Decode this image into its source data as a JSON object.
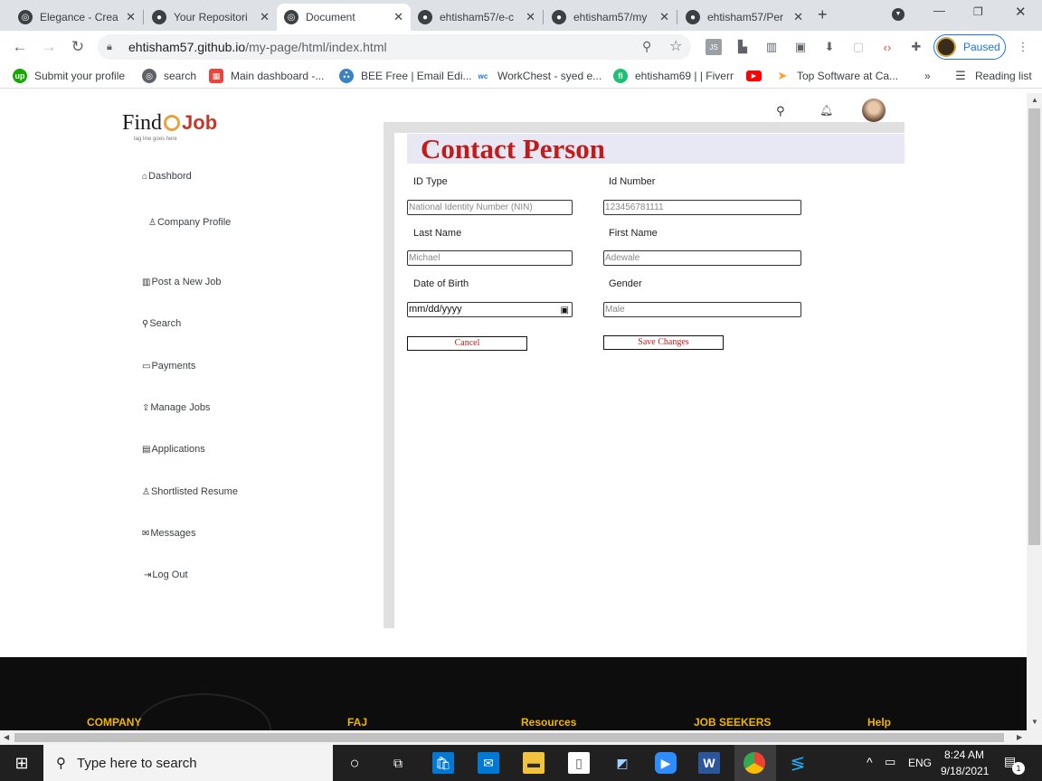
{
  "browser": {
    "tabs": [
      {
        "title": "Elegance - Crea",
        "active": false
      },
      {
        "title": "Your Repositori",
        "active": false
      },
      {
        "title": "Document",
        "active": true
      },
      {
        "title": "ehtisham57/e-c",
        "active": false
      },
      {
        "title": "ehtisham57/my",
        "active": false
      },
      {
        "title": "ehtisham57/Per",
        "active": false
      }
    ],
    "url_host": "ehtisham57.github.io",
    "url_path": "/my-page/html/index.html",
    "profile_status": "Paused",
    "bookmarks": [
      {
        "label": "Submit your profile",
        "icon": "upwork-icon",
        "color": "#14a800"
      },
      {
        "label": "search",
        "icon": "globe-icon",
        "color": "#5f6368"
      },
      {
        "label": "Main dashboard -...",
        "icon": "dashboard-icon",
        "color": "#e8453c"
      },
      {
        "label": "BEE Free | Email Edi...",
        "icon": "bee-icon",
        "color": "#3b82c4"
      },
      {
        "label": "WorkChest - syed e...",
        "icon": "workchest-icon",
        "color": "#1a73e8"
      },
      {
        "label": "ehtisham69 | | Fiverr",
        "icon": "fiverr-icon",
        "color": "#1dbf73"
      },
      {
        "label": "",
        "icon": "youtube-icon",
        "color": "#ff0000"
      },
      {
        "label": "Top Software at Ca...",
        "icon": "capterra-icon",
        "color": "#ff9d28"
      }
    ],
    "more_bookmarks": "»",
    "reading_list": "Reading list"
  },
  "logo": {
    "find": "Find",
    "job": "Job",
    "tagline": "tag line goes here"
  },
  "sidebar": {
    "items": [
      {
        "label": "Dashbord",
        "icon": "home-icon",
        "glyph": "⌂"
      },
      {
        "label": "Company Profile",
        "icon": "user-icon",
        "glyph": "♙"
      },
      {
        "label": "Post a New Job",
        "icon": "briefcase-icon",
        "glyph": "▥"
      },
      {
        "label": "Search",
        "icon": "search-icon",
        "glyph": "⚲"
      },
      {
        "label": "Payments",
        "icon": "credit-card-icon",
        "glyph": "▭"
      },
      {
        "label": "Manage Jobs",
        "icon": "upload-icon",
        "glyph": "⇪"
      },
      {
        "label": "Applications",
        "icon": "document-icon",
        "glyph": "▤"
      },
      {
        "label": "Shortlisted Resume",
        "icon": "user-icon",
        "glyph": "♙"
      },
      {
        "label": "Messages",
        "icon": "envelope-icon",
        "glyph": "✉"
      },
      {
        "label": "Log Out",
        "icon": "logout-icon",
        "glyph": "⇥"
      }
    ]
  },
  "form": {
    "title": "Contact Person",
    "id_type_label": "ID Type",
    "id_type_value": "National Identity Number (NIN)",
    "id_number_label": "Id Number",
    "id_number_value": "123456781111",
    "last_name_label": "Last Name",
    "last_name_value": "Michael",
    "first_name_label": "First Name",
    "first_name_value": "Adewale",
    "dob_label": "Date of Birth",
    "dob_placeholder": "mm/dd/yyyy",
    "gender_label": "Gender",
    "gender_value": "Male",
    "cancel_label": "Cancel",
    "save_label": "Save Changes"
  },
  "footer": {
    "columns": [
      "COMPANY",
      "FAJ",
      "Resources",
      "JOB SEEKERS",
      "Help"
    ]
  },
  "taskbar": {
    "search_placeholder": "Type here to search",
    "language": "ENG",
    "time": "8:24 AM",
    "date": "9/18/2021",
    "notification_count": "1"
  }
}
